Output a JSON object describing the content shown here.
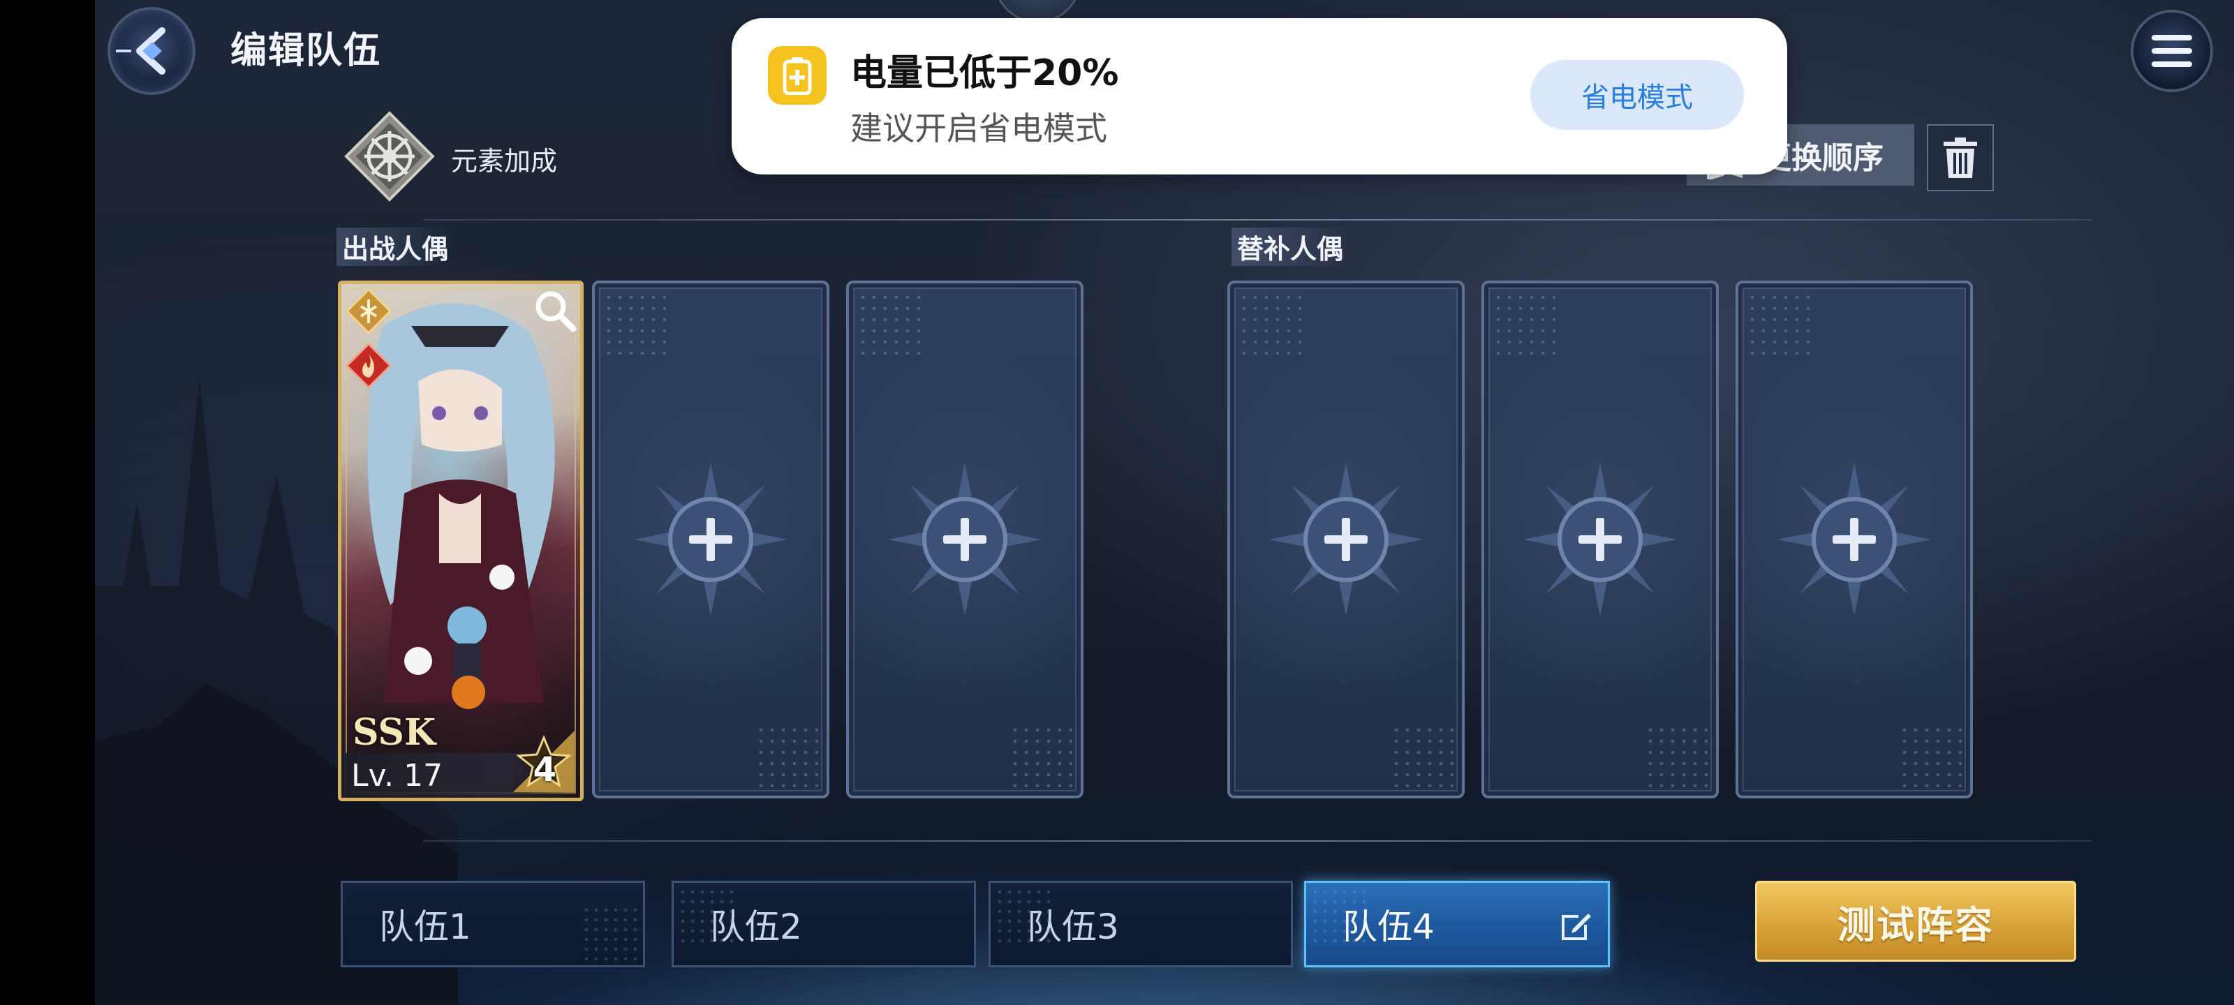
{
  "header": {
    "title": "编辑队伍",
    "element_bonus_label": "元素加成"
  },
  "toolbar": {
    "reorder_label": "更换顺序"
  },
  "sections": {
    "battle_label": "出战人偶",
    "substitute_label": "替补人偶"
  },
  "character": {
    "rarity": "SSK",
    "level": "Lv. 17",
    "stars": "4"
  },
  "teams": [
    {
      "label": "队伍1"
    },
    {
      "label": "队伍2"
    },
    {
      "label": "队伍3"
    },
    {
      "label": "队伍4"
    }
  ],
  "active_team": "队伍4",
  "test_button": "测试阵容",
  "notification": {
    "title": "电量已低于20%",
    "body": "建议开启省电模式",
    "action": "省电模式"
  },
  "colors": {
    "accent_gold": "#d9a33a",
    "active_tab": "#2b6fb8",
    "notif_button_text": "#2a7de1",
    "battery_icon": "#f5c320"
  }
}
